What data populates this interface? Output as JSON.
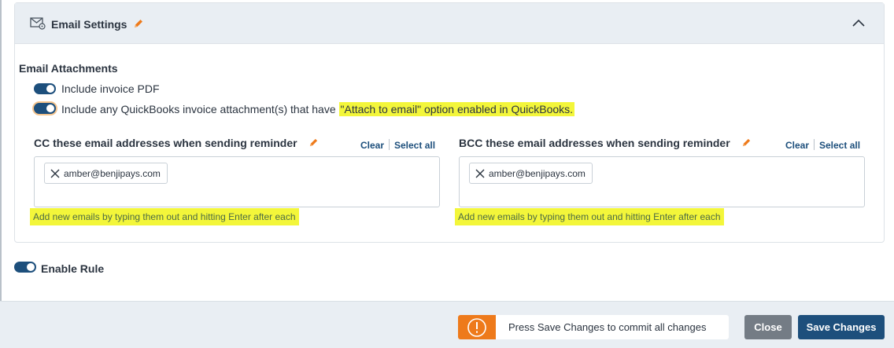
{
  "email_settings": {
    "title": "Email Settings",
    "attachments": {
      "title": "Email Attachments",
      "include_pdf": {
        "label": "Include invoice PDF",
        "enabled": true
      },
      "include_qb": {
        "label": "Include any QuickBooks invoice attachment(s) that have ",
        "label_highlight": "\"Attach to email\" option enabled in QuickBooks.",
        "enabled": true
      }
    },
    "cc": {
      "title": "CC these email addresses when sending reminder",
      "clear_label": "Clear",
      "select_all_label": "Select all",
      "emails": [
        "amber@benjipays.com"
      ],
      "hint": "Add new emails by typing them out and hitting Enter after each"
    },
    "bcc": {
      "title": "BCC these email addresses when sending reminder",
      "clear_label": "Clear",
      "select_all_label": "Select all",
      "emails": [
        "amber@benjipays.com"
      ],
      "hint": "Add new emails by typing them out and hitting Enter after each"
    }
  },
  "enable_rule": {
    "label": "Enable Rule",
    "enabled": true
  },
  "footer": {
    "notice": "Press Save Changes to commit all changes",
    "close_label": "Close",
    "save_label": "Save Changes"
  },
  "colors": {
    "primary": "#1d4f7c",
    "accent_orange": "#ee7a1b",
    "highlight": "#f3f63a",
    "header_bg": "#e9eef3",
    "close_button": "#747c85"
  }
}
